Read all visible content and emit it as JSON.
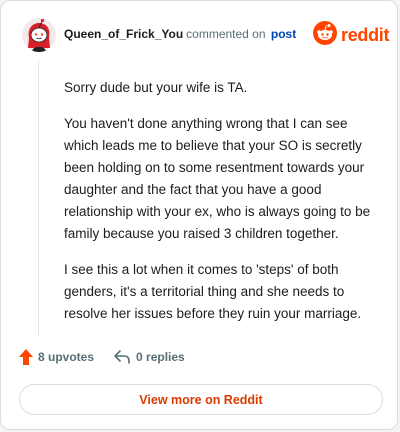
{
  "header": {
    "username": "Queen_of_Frick_You",
    "action_text": "commented on",
    "post_link": "post",
    "brand": "reddit",
    "avatar_icon": "snoo-avatar-icon",
    "brand_icon": "reddit-alien-icon"
  },
  "comment": {
    "paragraphs": [
      "Sorry dude but your wife is TA.",
      "You haven't done anything wrong that I can see which leads me to believe that your SO is secretly been holding on to some resentment towards your daughter and the fact that you have a good relationship with your ex, who is always going to be family because you raised 3 children together.",
      "I see this a lot when it comes to 'steps' of both genders, it's a territorial thing and she needs to resolve her issues before they ruin your marriage."
    ]
  },
  "footer": {
    "upvotes": "8 upvotes",
    "replies": "0 replies",
    "upvote_icon": "upvote-arrow-icon",
    "reply_icon": "reply-arrow-icon"
  },
  "view_more": {
    "label": "View more on Reddit"
  },
  "colors": {
    "brand": "#ff4500",
    "link": "#0045ac",
    "muted": "#576f76",
    "cta": "#d93a00"
  }
}
